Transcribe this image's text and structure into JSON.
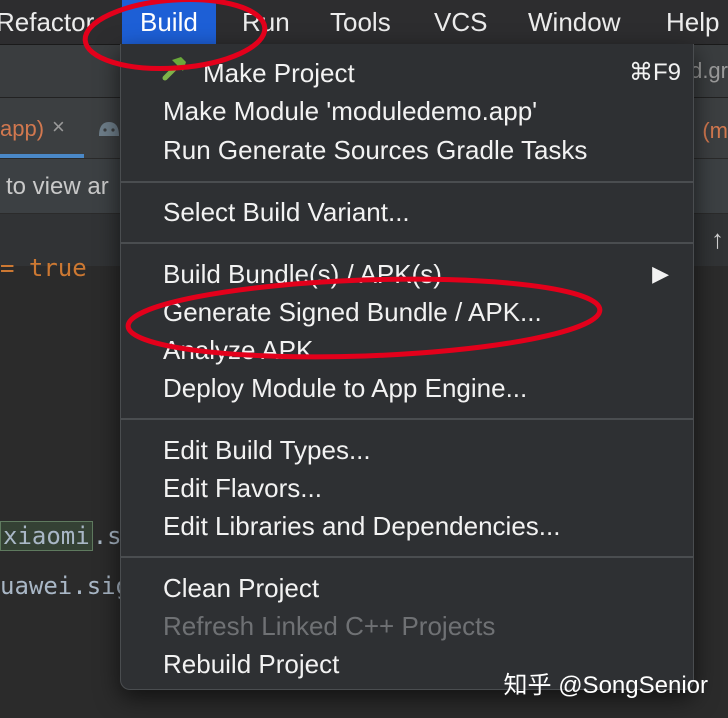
{
  "menubar": {
    "items": [
      "Refactor",
      "Build",
      "Run",
      "Tools",
      "VCS",
      "Window",
      "Help"
    ],
    "active": "Build"
  },
  "ide": {
    "tab_label": "app)",
    "tab_close": "×",
    "notice_text": "to view ar",
    "right_url": "d.gr",
    "right_tab": "(m",
    "right_arrow": "↑",
    "code": {
      "line1_prefix": "= ",
      "line1_value": "true",
      "line2_highlight": "xiaomi",
      "line2_rest": ".sig",
      "line3": "uawei.sig"
    }
  },
  "build_menu": {
    "groups": [
      [
        {
          "label": "Make Project",
          "shortcut": "⌘F9",
          "icon": "hammer-icon"
        },
        {
          "label": "Make Module 'moduledemo.app'"
        },
        {
          "label": "Run Generate Sources Gradle Tasks"
        }
      ],
      [
        {
          "label": "Select Build Variant..."
        }
      ],
      [
        {
          "label": "Build Bundle(s) / APK(s)",
          "submenu": true,
          "submenu_icon": "chevron-right-icon"
        },
        {
          "label": "Generate Signed Bundle / APK..."
        },
        {
          "label": "Analyze APK..."
        },
        {
          "label": "Deploy Module to App Engine..."
        }
      ],
      [
        {
          "label": "Edit Build Types..."
        },
        {
          "label": "Edit Flavors..."
        },
        {
          "label": "Edit Libraries and Dependencies..."
        }
      ],
      [
        {
          "label": "Clean Project"
        },
        {
          "label": "Refresh Linked C++ Projects",
          "disabled": true
        },
        {
          "label": "Rebuild Project"
        }
      ]
    ],
    "submenu_arrow": "▶"
  },
  "annotation_color": "#e3001b",
  "accent_color": "#1d5fd6",
  "watermark": "知乎 @SongSenior"
}
